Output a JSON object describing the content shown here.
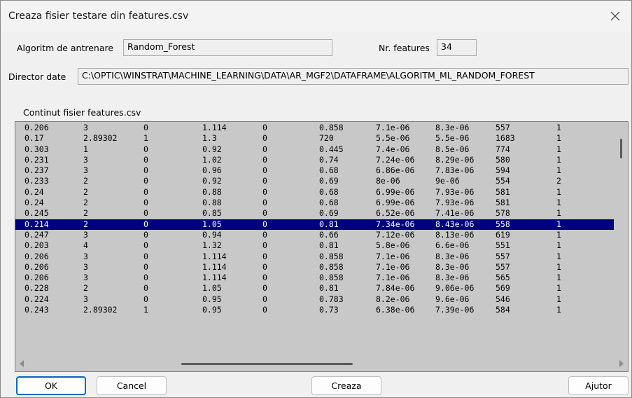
{
  "window": {
    "title": "Creaza fisier testare din features.csv"
  },
  "algorithm": {
    "label": "Algoritm de antrenare",
    "value": "Random_Forest"
  },
  "features": {
    "label": "Nr. features",
    "value": "34"
  },
  "directory": {
    "label": "Director date",
    "value": "C:\\OPTIC\\WINSTRAT\\MACHINE_LEARNING\\DATA\\AR_MGF2\\DATAFRAME\\ALGORITM_ML_RANDOM_FOREST"
  },
  "content": {
    "label": "Continut fisier features.csv"
  },
  "table": {
    "rows": [
      [
        "0.206",
        "3",
        "0",
        "1.114",
        "0",
        "0.858",
        "7.1e-06",
        "8.3e-06",
        "557",
        "1"
      ],
      [
        "0.17",
        "2.89302",
        "1",
        "1.3",
        "0",
        "720",
        "5.5e-06",
        "5.5e-06",
        "1683",
        "1"
      ],
      [
        "0.303",
        "1",
        "0",
        "0.92",
        "0",
        "0.445",
        "7.4e-06",
        "8.5e-06",
        "774",
        "1"
      ],
      [
        "0.231",
        "3",
        "0",
        "1.02",
        "0",
        "0.74",
        "7.24e-06",
        "8.29e-06",
        "580",
        "1"
      ],
      [
        "0.237",
        "3",
        "0",
        "0.96",
        "0",
        "0.68",
        "6.86e-06",
        "7.83e-06",
        "594",
        "1"
      ],
      [
        "0.233",
        "2",
        "0",
        "0.92",
        "0",
        "0.69",
        "8e-06",
        "9e-06",
        "554",
        "2"
      ],
      [
        "0.24",
        "2",
        "0",
        "0.88",
        "0",
        "0.68",
        "6.99e-06",
        "7.93e-06",
        "581",
        "1"
      ],
      [
        "0.24",
        "2",
        "0",
        "0.88",
        "0",
        "0.68",
        "6.99e-06",
        "7.93e-06",
        "581",
        "1"
      ],
      [
        "0.245",
        "2",
        "0",
        "0.85",
        "0",
        "0.69",
        "6.52e-06",
        "7.41e-06",
        "578",
        "1"
      ],
      [
        "0.214",
        "2",
        "0",
        "1.05",
        "0",
        "0.81",
        "7.34e-06",
        "8.43e-06",
        "558",
        "1"
      ],
      [
        "0.247",
        "3",
        "0",
        "0.94",
        "0",
        "0.66",
        "7.12e-06",
        "8.13e-06",
        "619",
        "1"
      ],
      [
        "0.203",
        "4",
        "0",
        "1.32",
        "0",
        "0.81",
        "5.8e-06",
        "6.6e-06",
        "551",
        "1"
      ],
      [
        "0.206",
        "3",
        "0",
        "1.114",
        "0",
        "0.858",
        "7.1e-06",
        "8.3e-06",
        "557",
        "1"
      ],
      [
        "0.206",
        "3",
        "0",
        "1.114",
        "0",
        "0.858",
        "7.1e-06",
        "8.3e-06",
        "557",
        "1"
      ],
      [
        "0.206",
        "3",
        "0",
        "1.114",
        "0",
        "0.858",
        "7.1e-06",
        "8.3e-06",
        "565",
        "1"
      ],
      [
        "0.228",
        "2",
        "0",
        "1.05",
        "0",
        "0.81",
        "7.84e-06",
        "9.06e-06",
        "569",
        "1"
      ],
      [
        "0.224",
        "3",
        "0",
        "0.95",
        "0",
        "0.783",
        "8.2e-06",
        "9.6e-06",
        "546",
        "1"
      ],
      [
        "0.243",
        "2.89302",
        "1",
        "0.95",
        "0",
        "0.73",
        "6.38e-06",
        "7.39e-06",
        "584",
        "1"
      ]
    ],
    "selected_row": 9
  },
  "buttons": {
    "ok": "OK",
    "cancel": "Cancel",
    "create": "Creaza",
    "help": "Ajutor"
  },
  "colors": {
    "selection": "#000080",
    "list_background": "#c8c8c8",
    "default_button_border": "#0067c0"
  }
}
